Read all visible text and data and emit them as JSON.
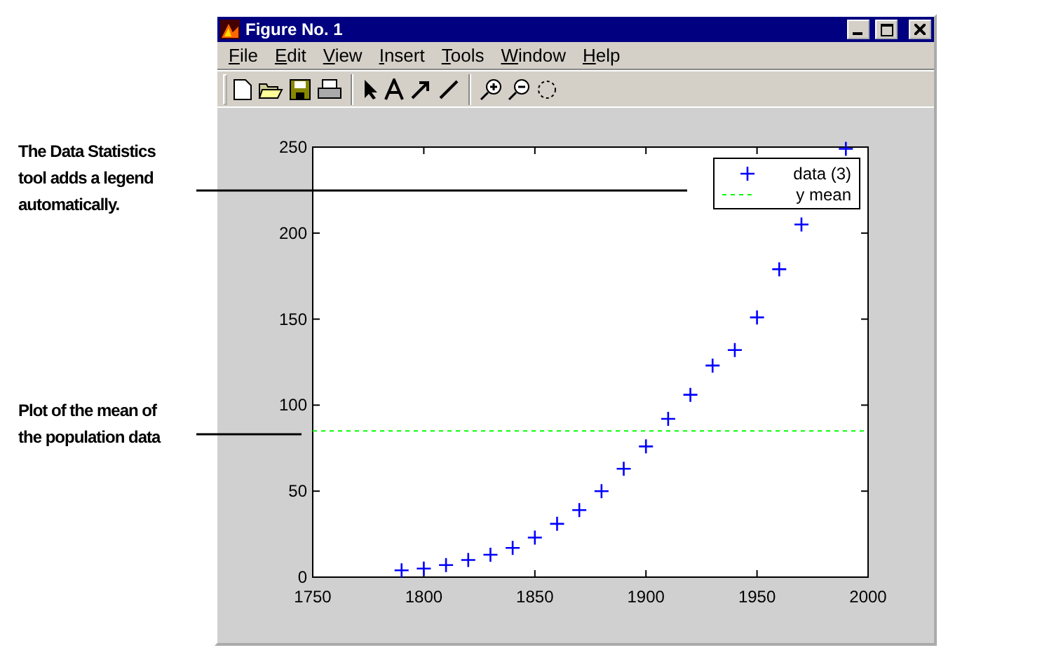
{
  "window": {
    "title": "Figure No. 1"
  },
  "menu": [
    {
      "label": "File"
    },
    {
      "label": "Edit"
    },
    {
      "label": "View"
    },
    {
      "label": "Insert"
    },
    {
      "label": "Tools"
    },
    {
      "label": "Window"
    },
    {
      "label": "Help"
    }
  ],
  "annotations": [
    {
      "text": "The Data Statistics tool adds a legend automatically."
    },
    {
      "text": "Plot of the mean of the population data"
    }
  ],
  "chart_data": {
    "type": "scatter",
    "x": [
      1790,
      1800,
      1810,
      1820,
      1830,
      1840,
      1850,
      1860,
      1870,
      1880,
      1890,
      1900,
      1910,
      1920,
      1930,
      1940,
      1950,
      1960,
      1970,
      1990
    ],
    "series": [
      {
        "name": "data (3)",
        "color": "#0000ff",
        "values": [
          4,
          5,
          7,
          10,
          13,
          17,
          23,
          31,
          39,
          50,
          63,
          76,
          92,
          106,
          123,
          132,
          151,
          179,
          205,
          249
        ]
      }
    ],
    "ref_lines": [
      {
        "axis": "y",
        "value": 85,
        "label": "y mean",
        "color": "#00ff00"
      }
    ],
    "legend": true,
    "xlim": [
      1750,
      2000
    ],
    "ylim": [
      0,
      250
    ],
    "xticks": [
      1750,
      1800,
      1850,
      1900,
      1950,
      2000
    ],
    "yticks": [
      0,
      50,
      100,
      150,
      200,
      250
    ]
  }
}
